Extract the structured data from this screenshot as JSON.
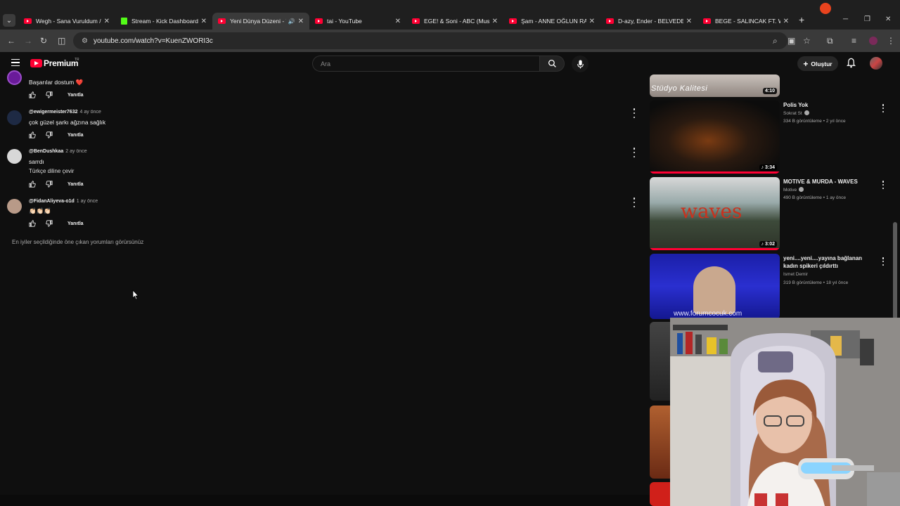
{
  "browser": {
    "tabs": [
      {
        "title": "Wegh - Sana Vuruldum /",
        "icon": "youtube-favicon",
        "active": false
      },
      {
        "title": "Stream - Kick Dashboard",
        "icon": "kick-favicon",
        "active": false
      },
      {
        "title": "Yeni Dünya Düzeni - Y",
        "icon": "youtube-favicon",
        "active": true,
        "audio": true
      },
      {
        "title": "tai - YouTube",
        "icon": "youtube-favicon",
        "active": false
      },
      {
        "title": "EGE! & Soni - ABC (Music",
        "icon": "youtube-favicon",
        "active": false
      },
      {
        "title": "Şam - ANNE OĞLUN RAP",
        "icon": "youtube-favicon",
        "active": false
      },
      {
        "title": "D-azy, Ender - BELVEDER",
        "icon": "youtube-favicon",
        "active": false
      },
      {
        "title": "BEGE - SALINCAK FT. WE",
        "icon": "youtube-favicon",
        "active": false
      }
    ],
    "url": "youtube.com/watch?v=KuenZWORI3c"
  },
  "youtube": {
    "brand": "Premium",
    "region": "TR",
    "search_placeholder": "Ara",
    "create_label": "Oluştur"
  },
  "comments": [
    {
      "author": "",
      "time": "",
      "text": "Başarılar dostum ❤️",
      "reply_label": "Yanıtla",
      "avatar_color": "#6a1b9a"
    },
    {
      "author": "@ewigermeister7632",
      "time": "4 ay önce",
      "text": "çok güzel şarkı ağzına sağlık",
      "reply_label": "Yanıtla",
      "avatar_color": "#1e2a44"
    },
    {
      "author": "@BenDushkaa",
      "time": "2 ay önce",
      "text": "sarrdı",
      "text2": "Türkçe diline çevir",
      "reply_label": "Yanıtla",
      "avatar_color": "#cfcfcf"
    },
    {
      "author": "@FidanAliyeva-o1d",
      "time": "1 ay önce",
      "text": "👏🏻👏🏻👏🏻",
      "reply_label": "Yanıtla",
      "avatar_color": "#b89a88"
    }
  ],
  "comments_notice": "En iyiler seçildiğinde öne çıkan yorumları görürsünüz",
  "sidebar": {
    "videos": [
      {
        "title": "",
        "channel": "",
        "meta": "",
        "duration": "4:10",
        "thumb_text": "Stüdyo Kalitesi"
      },
      {
        "title": "Polis Yok",
        "channel": "Sokrat St",
        "verified": true,
        "meta": "334 B görüntüleme • 2 yıl önce",
        "duration": "3:34",
        "music": true
      },
      {
        "title": "MOTIVE & MURDA - WAVES",
        "channel": "Motive",
        "verified": true,
        "meta": "490 B görüntüleme • 1 ay önce",
        "duration": "3:02",
        "music": true,
        "thumb_text": "waves"
      },
      {
        "title": "yeni....yeni....yayına bağlanan kadın spikeri çıldırttı",
        "channel": "Ismet Demir",
        "verified": false,
        "meta": "319 B görüntüleme • 18 yıl önce",
        "duration": "",
        "thumb_text": "www.forumcocuk.com"
      }
    ]
  },
  "colors": {
    "youtube_red": "#ff0033",
    "kick_green": "#53fc18",
    "background": "#0f0f0f"
  }
}
